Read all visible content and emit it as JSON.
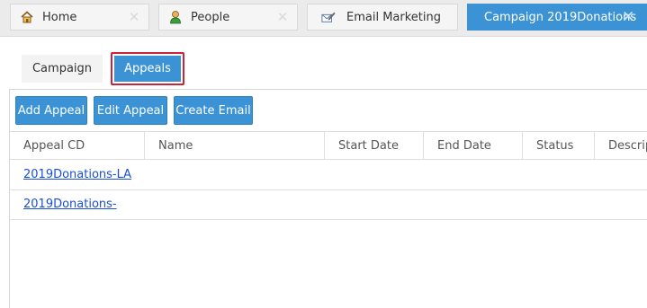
{
  "tabs": [
    {
      "label": "Home",
      "icon": "home-icon"
    },
    {
      "label": "People",
      "icon": "person-icon"
    },
    {
      "label": "Email Marketing",
      "icon": "email-edit-icon"
    },
    {
      "label": "Campaign 2019Donations",
      "icon": "close-icon",
      "active": true
    }
  ],
  "subtabs": {
    "campaign": "Campaign",
    "appeals": "Appeals"
  },
  "toolbar": {
    "add_label": "Add Appeal",
    "edit_label": "Edit Appeal",
    "create_email_label": "Create Email"
  },
  "table": {
    "headers": [
      "Appeal CD",
      "Name",
      "Start Date",
      "End Date",
      "Status",
      "Descript"
    ],
    "rows": [
      {
        "appeal_cd": "2019Donations-LA"
      },
      {
        "appeal_cd": "2019Donations-"
      }
    ]
  },
  "colors": {
    "accent": "#3b93d6",
    "highlight_border": "#c8253a",
    "link": "#1a4fd6"
  }
}
